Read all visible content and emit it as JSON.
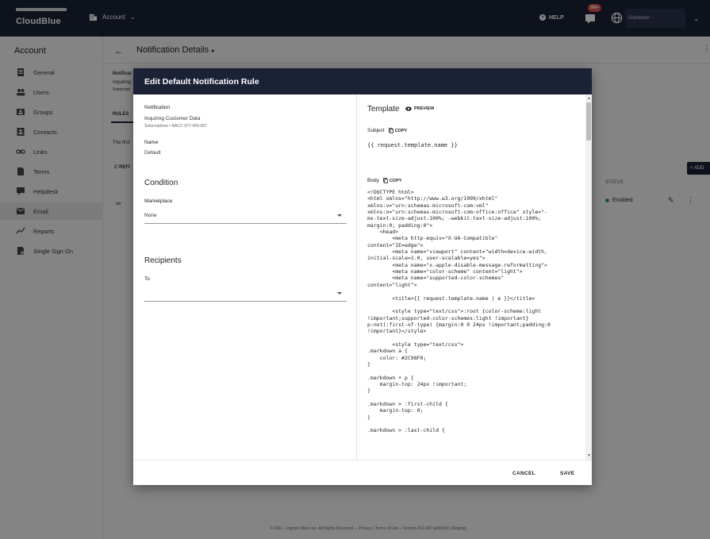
{
  "topbar": {
    "logo_text": "CloudBlue",
    "account_switcher": "Account",
    "help_label": "HELP",
    "notification_count": "999+",
    "role_label": "Distributor -"
  },
  "sidebar": {
    "title": "Account",
    "items": [
      {
        "label": "General",
        "icon": "document-icon"
      },
      {
        "label": "Users",
        "icon": "users-icon"
      },
      {
        "label": "Groups",
        "icon": "groups-icon"
      },
      {
        "label": "Contacts",
        "icon": "contacts-icon"
      },
      {
        "label": "Links",
        "icon": "link-icon"
      },
      {
        "label": "Terms",
        "icon": "terms-icon"
      },
      {
        "label": "Helpdesk",
        "icon": "helpdesk-icon"
      },
      {
        "label": "Email",
        "icon": "email-icon"
      },
      {
        "label": "Reports",
        "icon": "reports-icon"
      },
      {
        "label": "Single Sign On",
        "icon": "sso-icon"
      }
    ],
    "active_index": 7
  },
  "page": {
    "title": "Notification Details",
    "bg_notification": "Notificat",
    "bg_inquiring": "Inquiring",
    "bg_subscriptions": "Subscripti",
    "bg_rules_tab": "RULES",
    "bg_first": "The first",
    "bg_refresh": "C REFI",
    "add_label": "+ ADD",
    "status_header": "STATUS",
    "status_value": "Enabled",
    "footer": "© 2021 – Ingram Micro Inc. All Rights Reserved. – Privacy | Terms of Use – Version 24.0.467-g45b601 (Staging)"
  },
  "dialog": {
    "title": "Edit Default Notification Rule",
    "notification_label": "Notification",
    "notification_value": "Inquiring Customer Data",
    "notification_sub": "Subscriptions • NACC-977-436-087",
    "name_label": "Name",
    "name_value": "Default",
    "condition_header": "Condition",
    "marketplace_label": "Marketplace",
    "marketplace_value": "None",
    "recipients_header": "Recipients",
    "to_label": "To",
    "to_value": "",
    "template_title": "Template",
    "preview_label": "PREVIEW",
    "subject_label": "Subject",
    "subject_copy": "COPY",
    "subject_value": "{{ request.template.name }}",
    "body_label": "Body",
    "body_copy": "COPY",
    "body_code": "<!DOCTYPE html>\n<html xmlns=\"http://www.w3.org/1999/xhtml\"\nxmlns:v=\"urn:schemas-microsoft-com:vml\"\nxmlns:o=\"urn:schemas-microsoft-com:office:office\" style=\"-\nms-text-size-adjust:100%; -webkit-text-size-adjust:100%;\nmargin:0; padding:0\">\n    <head>\n        <meta http-equiv=\"X-UA-Compatible\"\ncontent=\"IE=edge\">\n        <meta name=\"viewport\" content=\"width=device-width,\ninitial-scale=1.0, user-scalable=yes\">\n        <meta name=\"x-apple-disable-message-reformatting\">\n        <meta name=\"color-scheme\" content=\"light\">\n        <meta name=\"supported-color-schemes\"\ncontent=\"light\">\n\n        <title>{{ request.template.name | e }}</title>\n\n        <style type=\"text/css\">:root {color-scheme:light\n!important;supported-color-schemes:light !important}\np:not(:first-of-type) {margin:0 0 24px !important;padding:0\n!important}</style>\n\n        <style type=\"text/css\">\n.markdown a {\n    color: #2C98F0;\n}\n\n.markdown + p {\n    margin-top: 24px !important;\n}\n\n.markdown > :first-child {\n    margin-top: 0;\n}\n\n.markdown > :last-child {",
    "cancel_label": "CANCEL",
    "save_label": "SAVE"
  },
  "colors": {
    "header_dark": "#1b2236",
    "status_green": "#2e9e4f",
    "badge_red": "#d9534f"
  }
}
